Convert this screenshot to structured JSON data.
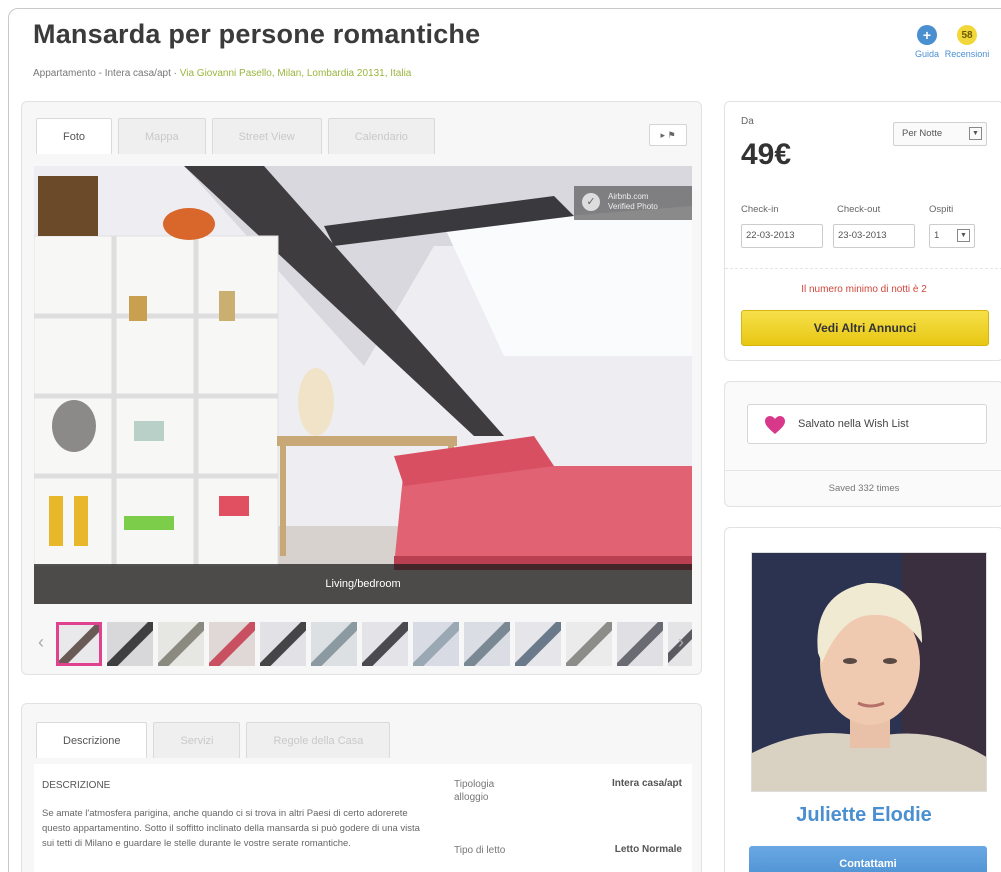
{
  "header": {
    "title": "Mansarda per persone romantiche",
    "property_type": "Appartamento - Intera casa/apt",
    "separator": " · ",
    "address": "Via Giovanni Pasello, Milan, Lombardia 20131, Italia",
    "guide_label": "Guida",
    "reviews_count": "58",
    "reviews_label": "Recensioni"
  },
  "photo_panel": {
    "tabs": [
      "Foto",
      "Mappa",
      "Street View",
      "Calendario"
    ],
    "active_tab": "Foto",
    "caption": "Living/bedroom",
    "watermark": "Airbnb.com",
    "watermark_sub": "Verified Photo",
    "thumbnail_count": 13
  },
  "description_panel": {
    "tabs": [
      "Descrizione",
      "Servizi",
      "Regole della Casa"
    ],
    "heading": "DESCRIZIONE",
    "text": "Se amate l'atmosfera parigina, anche quando ci si trova in altri Paesi di certo adorerete questo appartamentino. Sotto il soffitto inclinato della mansarda si può godere di una vista sui tetti di Milano e guardare le stelle durante le vostre serate romantiche.",
    "attributes": [
      {
        "label": "Tipologia alloggio",
        "value": "Intera casa/apt"
      },
      {
        "label": "Tipo di letto",
        "value": "Letto Normale"
      }
    ]
  },
  "booking": {
    "from_label": "Da",
    "price": "49€",
    "period": "Per Notte",
    "checkin_label": "Check-in",
    "checkout_label": "Check-out",
    "guests_label": "Ospiti",
    "checkin": "22-03-2013",
    "checkout": "23-03-2013",
    "guests": "1",
    "min_nights_notice": "Il numero minimo di notti è 2",
    "cta": "Vedi Altri Annunci"
  },
  "wishlist": {
    "label": "Salvato nella Wish List",
    "saved_times": "Saved 332 times"
  },
  "host": {
    "name": "Juliette Elodie",
    "contact": "Contattami"
  },
  "colors": {
    "accent_blue": "#4a8fd0",
    "cta_yellow": "#f2d73a",
    "heart_pink": "#e0428d",
    "notice_red": "#d0453a"
  }
}
